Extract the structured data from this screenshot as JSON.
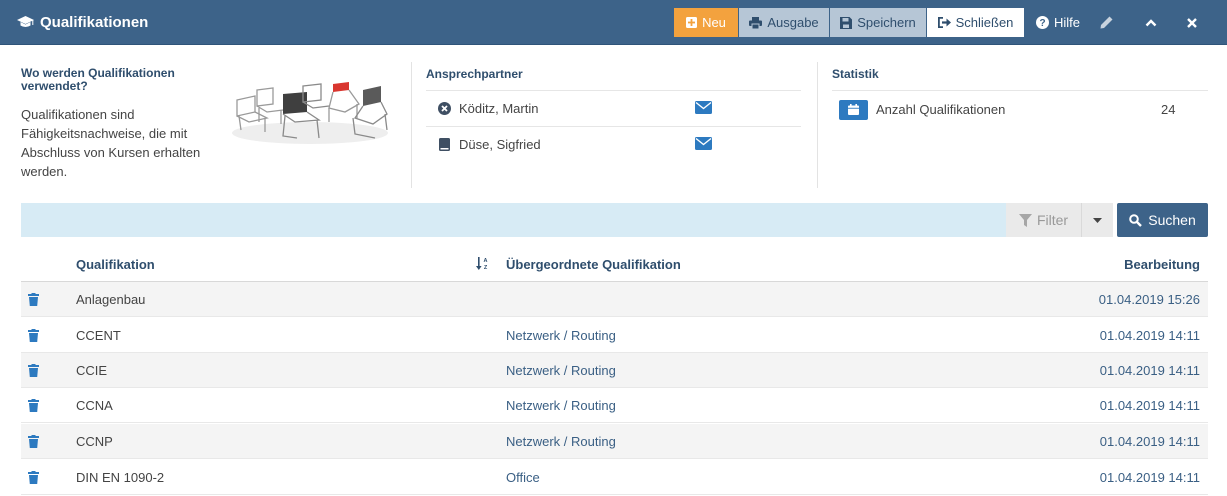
{
  "header": {
    "title": "Qualifikationen",
    "buttons": {
      "neu": "Neu",
      "ausgabe": "Ausgabe",
      "speichern": "Speichern",
      "schliessen": "Schließen",
      "hilfe": "Hilfe"
    }
  },
  "info": {
    "question": "Wo werden Qualifikationen verwendet?",
    "description": "Qualifikationen sind Fähigkeitsnachweise, die mit Abschluss von Kursen erhalten werden."
  },
  "contacts": {
    "heading": "Ansprechpartner",
    "items": [
      {
        "name": "Köditz, Martin",
        "icon": "times-circle-icon"
      },
      {
        "name": "Düse, Sigfried",
        "icon": "book-icon"
      }
    ]
  },
  "statistics": {
    "heading": "Statistik",
    "label": "Anzahl Qualifikationen",
    "value": "24"
  },
  "toolbar": {
    "filter_label": "Filter",
    "search_label": "Suchen"
  },
  "table": {
    "columns": {
      "qualifikation": "Qualifikation",
      "uebergeordnet": "Übergeordnete Qualifikation",
      "bearbeitung": "Bearbeitung"
    },
    "rows": [
      {
        "name": "Anlagenbau",
        "parent": "",
        "edited": "01.04.2019 15:26"
      },
      {
        "name": "CCENT",
        "parent": "Netzwerk / Routing",
        "edited": "01.04.2019 14:11"
      },
      {
        "name": "CCIE",
        "parent": "Netzwerk / Routing",
        "edited": "01.04.2019 14:11"
      },
      {
        "name": "CCNA",
        "parent": "Netzwerk / Routing",
        "edited": "01.04.2019 14:11"
      },
      {
        "name": "CCNP",
        "parent": "Netzwerk / Routing",
        "edited": "01.04.2019 14:11"
      },
      {
        "name": "DIN EN 1090-2",
        "parent": "Office",
        "edited": "01.04.2019 14:11"
      }
    ]
  },
  "colors": {
    "header_bg": "#3d6389",
    "accent_orange": "#f3a23e",
    "link_blue": "#2d7ac0",
    "filter_bg": "#d7ebf5"
  }
}
